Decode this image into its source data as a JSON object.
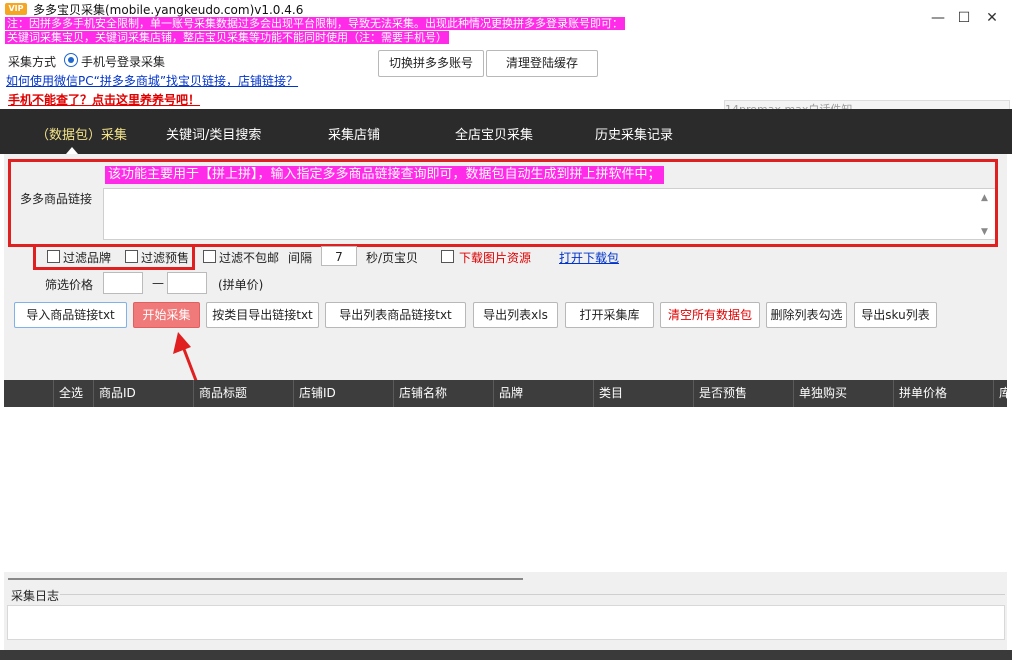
{
  "window": {
    "badge": "VIP",
    "title": "多多宝贝采集(mobile.yangkeudo.com)v1.0.4.6",
    "notice_line1": "注：因拼多多手机安全限制，单一账号采集数据过多会出现平台限制，导致无法采集。出现此种情况更换拼多多登录账号即可：",
    "notice_line2": "关键词采集宝贝，关键词采集店铺，整店宝贝采集等功能不能同时使用（注：需要手机号）",
    "controls": {
      "minimize": "—",
      "maximize": "☐",
      "close": "✕"
    }
  },
  "header": {
    "mode_label": "采集方式",
    "mode_option": "手机号登录采集",
    "help_link": "如何使用微信PC“拼多多商城”找宝贝链接，店铺链接？",
    "phone_link": "手机不能查了？点击这里养养号吧！",
    "switch_account_button": "切换拼多多账号",
    "clear_cache_button": "清理登陆缓存",
    "ghost_search_text": "14promax max白话件知"
  },
  "nav": {
    "tabs": [
      {
        "label": "（数据包）采集",
        "active": true
      },
      {
        "label": "关键词/类目搜索",
        "active": false
      },
      {
        "label": "采集店铺",
        "active": false
      },
      {
        "label": "全店宝贝采集",
        "active": false
      },
      {
        "label": "历史采集记录",
        "active": false
      }
    ]
  },
  "main": {
    "tip_banner": "该功能主要用于【拼上拼】，输入指定多多商品链接查询即可，数据包自动生成到拼上拼软件中；",
    "link_label": "多多商品链接",
    "link_value": "",
    "options": {
      "filter_brand": "过滤品牌",
      "filter_presale": "过滤预售",
      "filter_no_free_shipping": "过滤不包邮",
      "interval_label": "间隔",
      "interval_value": "7",
      "interval_unit": "秒/页宝贝",
      "download_images": "下载图片资源",
      "open_download_dir": "打开下载包"
    },
    "price_filter": {
      "label": "筛选价格",
      "min": "",
      "dash": "—",
      "max": "",
      "unit": "(拼单价)"
    },
    "actions": {
      "import_links": "导入商品链接txt",
      "start": "开始采集",
      "export_by_category": "按类目导出链接txt",
      "export_list_links": "导出列表商品链接txt",
      "export_xls": "导出列表xls",
      "open_library": "打开采集库",
      "clear_all": "清空所有数据包",
      "delete_checked": "删除列表勾选",
      "export_sku": "导出sku列表"
    }
  },
  "table": {
    "columns": [
      "",
      "全选",
      "商品ID",
      "商品标题",
      "店铺ID",
      "店铺名称",
      "品牌",
      "类目",
      "是否预售",
      "单独购买",
      "拼单价格",
      "库"
    ],
    "rows": []
  },
  "log": {
    "label": "采集日志",
    "content": ""
  },
  "colors": {
    "accent_magenta": "#ff2be8",
    "highlight_red": "#e02020",
    "nav_bg": "#2b2b2b",
    "link_blue": "#0033cc"
  }
}
